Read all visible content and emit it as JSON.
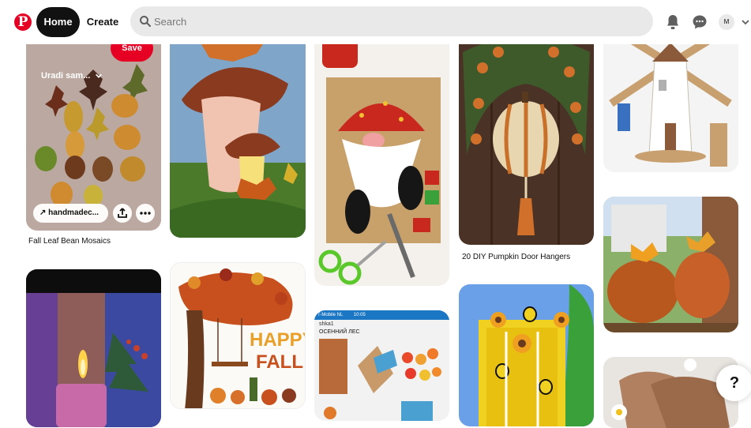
{
  "header": {
    "logo": "P",
    "home_label": "Home",
    "create_label": "Create",
    "search_placeholder": "Search",
    "avatar_initial": "M"
  },
  "pins": {
    "bean": {
      "board_label": "Uradi sam...",
      "save_label": "Save",
      "link_label": "handmadec...",
      "title": "Fall Leaf Bean Mosaics"
    },
    "pumpkin": {
      "title": "20 DIY Pumpkin Door Hangers"
    },
    "happyfall": {
      "line1": "HAPPY",
      "line2": "FALL"
    },
    "phone": {
      "status": "T-Mobile NL",
      "time": "10:05",
      "line1": "shka1",
      "line2": "ОСЕННИЙ ЛЕС"
    }
  },
  "help_label": "?"
}
